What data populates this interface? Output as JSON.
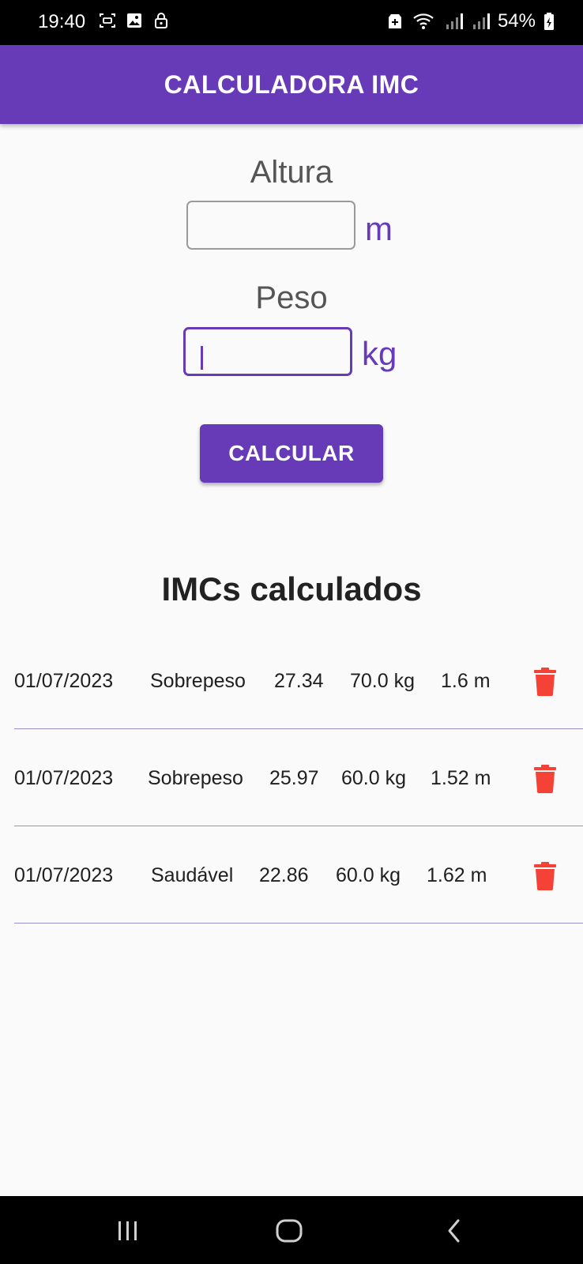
{
  "status_bar": {
    "time": "19:40",
    "battery": "54%",
    "icons_left": [
      "screen-record-icon",
      "image-icon",
      "lock-icon"
    ],
    "icons_right": [
      "data-saver-icon",
      "wifi-icon",
      "signal-icon",
      "signal-icon",
      "battery-icon"
    ]
  },
  "app_bar": {
    "title": "CALCULADORA IMC",
    "color": "#673ab7"
  },
  "form": {
    "altura": {
      "label": "Altura",
      "value": "",
      "unit": "m"
    },
    "peso": {
      "label": "Peso",
      "value": "",
      "unit": "kg"
    },
    "button_label": "CALCULAR"
  },
  "history": {
    "title": "IMCs calculados",
    "items": [
      {
        "date": "01/07/2023",
        "category": "Sobrepeso",
        "imc": "27.34",
        "weight": "70.0 kg",
        "height": "1.6 m"
      },
      {
        "date": "01/07/2023",
        "category": "Sobrepeso",
        "imc": "25.97",
        "weight": "60.0 kg",
        "height": "1.52 m"
      },
      {
        "date": "01/07/2023",
        "category": "Saudável",
        "imc": "22.86",
        "weight": "60.0 kg",
        "height": "1.62 m"
      }
    ],
    "delete_icon_color": "#f44336"
  },
  "nav_bar": {
    "buttons": [
      "recents-icon",
      "home-icon",
      "back-icon"
    ]
  }
}
